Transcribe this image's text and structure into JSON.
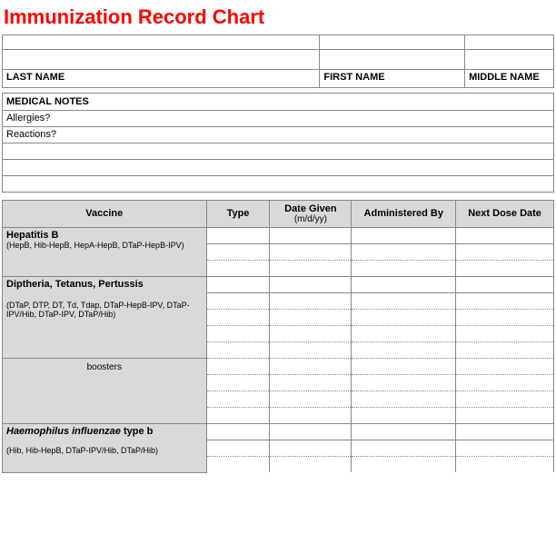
{
  "title": "Immunization Record Chart",
  "name_headers": {
    "last": "LAST NAME",
    "first": "FIRST NAME",
    "middle": "MIDDLE NAME"
  },
  "medical_notes": {
    "header": "MEDICAL NOTES",
    "rows": [
      "Allergies?",
      "Reactions?",
      "",
      "",
      ""
    ]
  },
  "vac_headers": {
    "vaccine": "Vaccine",
    "type": "Type",
    "date": "Date Given",
    "date_sub": "(m/d/yy)",
    "admin": "Administered By",
    "next": "Next Dose Date"
  },
  "vaccines": {
    "hepb": {
      "name": "Hepatitis B",
      "detail": "(HepB, Hib-HepB, HepA-HepB, DTaP-HepB-IPV)"
    },
    "dtp": {
      "name": "Diptheria, Tetanus, Pertussis",
      "detail": "(DTaP, DTP, DT, Td, Tdap, DTaP-HepB-IPV, DTaP-IPV/Hib, DTaP-IPV, DTaP/Hib)",
      "boosters": "boosters"
    },
    "hib": {
      "name_html_pre": "Haemophilus influenzae",
      "name_suffix": " type b",
      "detail": "(Hib, Hib-HepB, DTaP-IPV/Hib, DTaP/Hib)"
    }
  }
}
